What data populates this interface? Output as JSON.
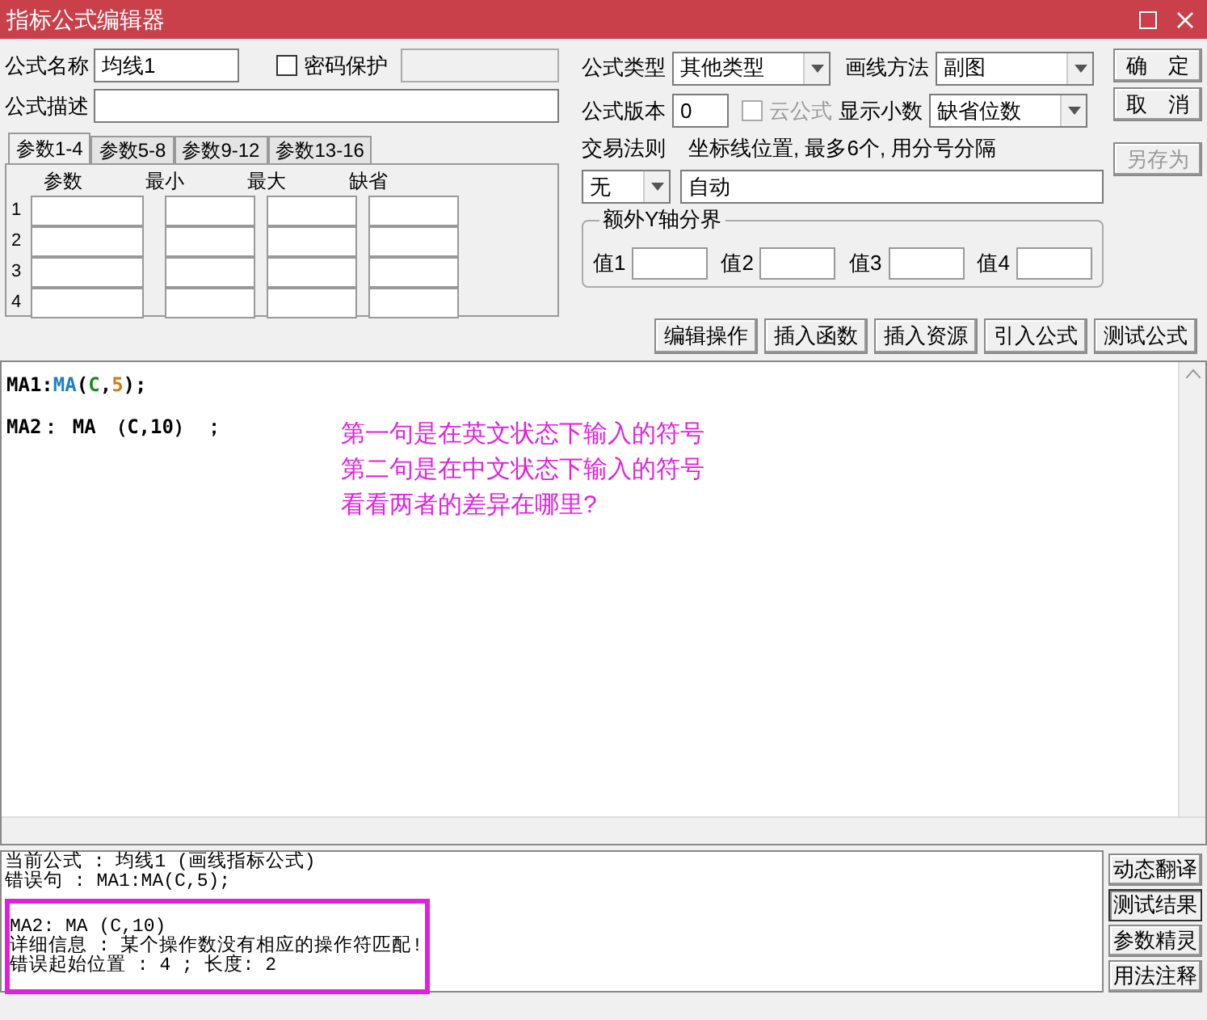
{
  "window": {
    "title": "指标公式编辑器"
  },
  "name_field": {
    "label": "公式名称",
    "value": "均线1"
  },
  "password": {
    "label": "密码保护",
    "checked": false
  },
  "desc_field": {
    "label": "公式描述"
  },
  "type_select": {
    "label": "公式类型",
    "value": "其他类型"
  },
  "draw_select": {
    "label": "画线方法",
    "value": "副图"
  },
  "version_field": {
    "label": "公式版本",
    "value": "0"
  },
  "cloud": {
    "label": "云公式",
    "checked": false,
    "disabled": true
  },
  "decimals_select": {
    "label": "显示小数",
    "value": "缺省位数"
  },
  "buttons": [
    {
      "label": "确　定",
      "disabled": false
    },
    {
      "label": "取　消",
      "disabled": false
    },
    {
      "label": "另存为",
      "disabled": true
    }
  ],
  "param_tabs": [
    {
      "label": "参数1-4",
      "selected": true
    },
    {
      "label": "参数5-8",
      "selected": false
    },
    {
      "label": "参数9-12",
      "selected": false
    },
    {
      "label": "参数13-16",
      "selected": false
    }
  ],
  "param_table": {
    "columns": [
      "参数",
      "最小",
      "最大",
      "缺省"
    ],
    "rows": [
      "1",
      "2",
      "3",
      "4"
    ]
  },
  "trade_rule": {
    "label": "交易法则",
    "value": "无"
  },
  "axis": {
    "label": "坐标线位置, 最多6个, 用分号分隔",
    "value": "自动"
  },
  "extra_axis": {
    "title": "额外Y轴分界",
    "fields": [
      "值1",
      "值2",
      "值3",
      "值4"
    ]
  },
  "tool_buttons": [
    "编辑操作",
    "插入函数",
    "插入资源",
    "引入公式",
    "测试公式"
  ],
  "code_lines": [
    [
      {
        "text": "MA1:",
        "color": "#000000"
      },
      {
        "text": "MA",
        "color": "#1e7fc8"
      },
      {
        "text": "(",
        "color": "#000000"
      },
      {
        "text": "C",
        "color": "#1a8a1a"
      },
      {
        "text": ",",
        "color": "#000000"
      },
      {
        "text": "5",
        "color": "#d07a10"
      },
      {
        "text": ");",
        "color": "#000000"
      }
    ],
    [
      {
        "text": "MA2： MA （C,10） ；",
        "color": "#000000"
      }
    ]
  ],
  "annotation": [
    "第一句是在英文状态下输入的符号",
    "第二句是在中文状态下输入的符号",
    "看看两者的差异在哪里?"
  ],
  "output": {
    "lines": [
      "当前公式 : 均线1 (画线指标公式)",
      "错误句 : MA1:MA(C,5);"
    ],
    "highlighted": [
      "MA2: MA (C,10)",
      "详细信息 : 某个操作数没有相应的操作符匹配!",
      "错误起始位置 : 4 ; 长度: 2"
    ]
  },
  "side_buttons": [
    {
      "label": "动态翻译",
      "selected": false
    },
    {
      "label": "测试结果",
      "selected": true
    },
    {
      "label": "参数精灵",
      "selected": false
    },
    {
      "label": "用法注释",
      "selected": false
    }
  ]
}
